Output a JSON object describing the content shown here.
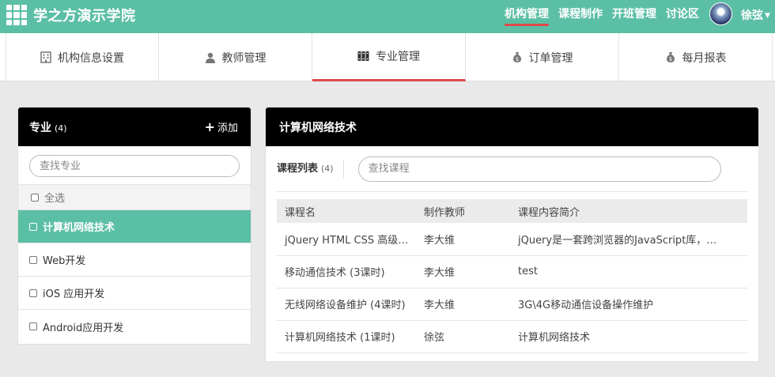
{
  "brand": {
    "title": "学之方演示学院",
    "logo_icon": "grid-logo-icon"
  },
  "topnav": [
    {
      "label": "机构管理",
      "active": true
    },
    {
      "label": "课程制作",
      "active": false
    },
    {
      "label": "开班管理",
      "active": false
    },
    {
      "label": "讨论区",
      "active": false
    }
  ],
  "user": {
    "name": "徐弦"
  },
  "tabs": [
    {
      "label": "机构信息设置",
      "icon": "building-icon"
    },
    {
      "label": "教师管理",
      "icon": "user-icon"
    },
    {
      "label": "专业管理",
      "icon": "books-icon",
      "active": true
    },
    {
      "label": "订单管理",
      "icon": "money-bag-icon"
    },
    {
      "label": "每月报表",
      "icon": "money-bag-icon"
    }
  ],
  "majors": {
    "title": "专业",
    "count": "(4)",
    "add_label": "添加",
    "search_placeholder": "查找专业",
    "select_all": "全选",
    "items": [
      {
        "label": "计算机网络技术",
        "active": true
      },
      {
        "label": "Web开发",
        "active": false
      },
      {
        "label": "iOS 应用开发",
        "active": false
      },
      {
        "label": "Android应用开发",
        "active": false
      }
    ]
  },
  "detail": {
    "title": "计算机网络技术",
    "list_label": "课程列表",
    "list_count": "(4)",
    "search_placeholder": "查找课程",
    "columns": [
      "课程名",
      "制作教师",
      "课程内容简介"
    ],
    "rows": [
      [
        "jQuery HTML CSS 高级…",
        "李大维",
        "jQuery是一套跨浏览器的JavaScript库，…"
      ],
      [
        "移动通信技术 (3课时)",
        "李大维",
        "test"
      ],
      [
        "无线网络设备维护 (4课时)",
        "李大维",
        "3G\\4G移动通信设备操作维护"
      ],
      [
        "计算机网络技术 (1课时)",
        "徐弦",
        "计算机网络技术"
      ]
    ]
  },
  "colors": {
    "accent": "#5bbfa5",
    "active_underline": "#e04a4a",
    "header_dark": "#000000"
  }
}
